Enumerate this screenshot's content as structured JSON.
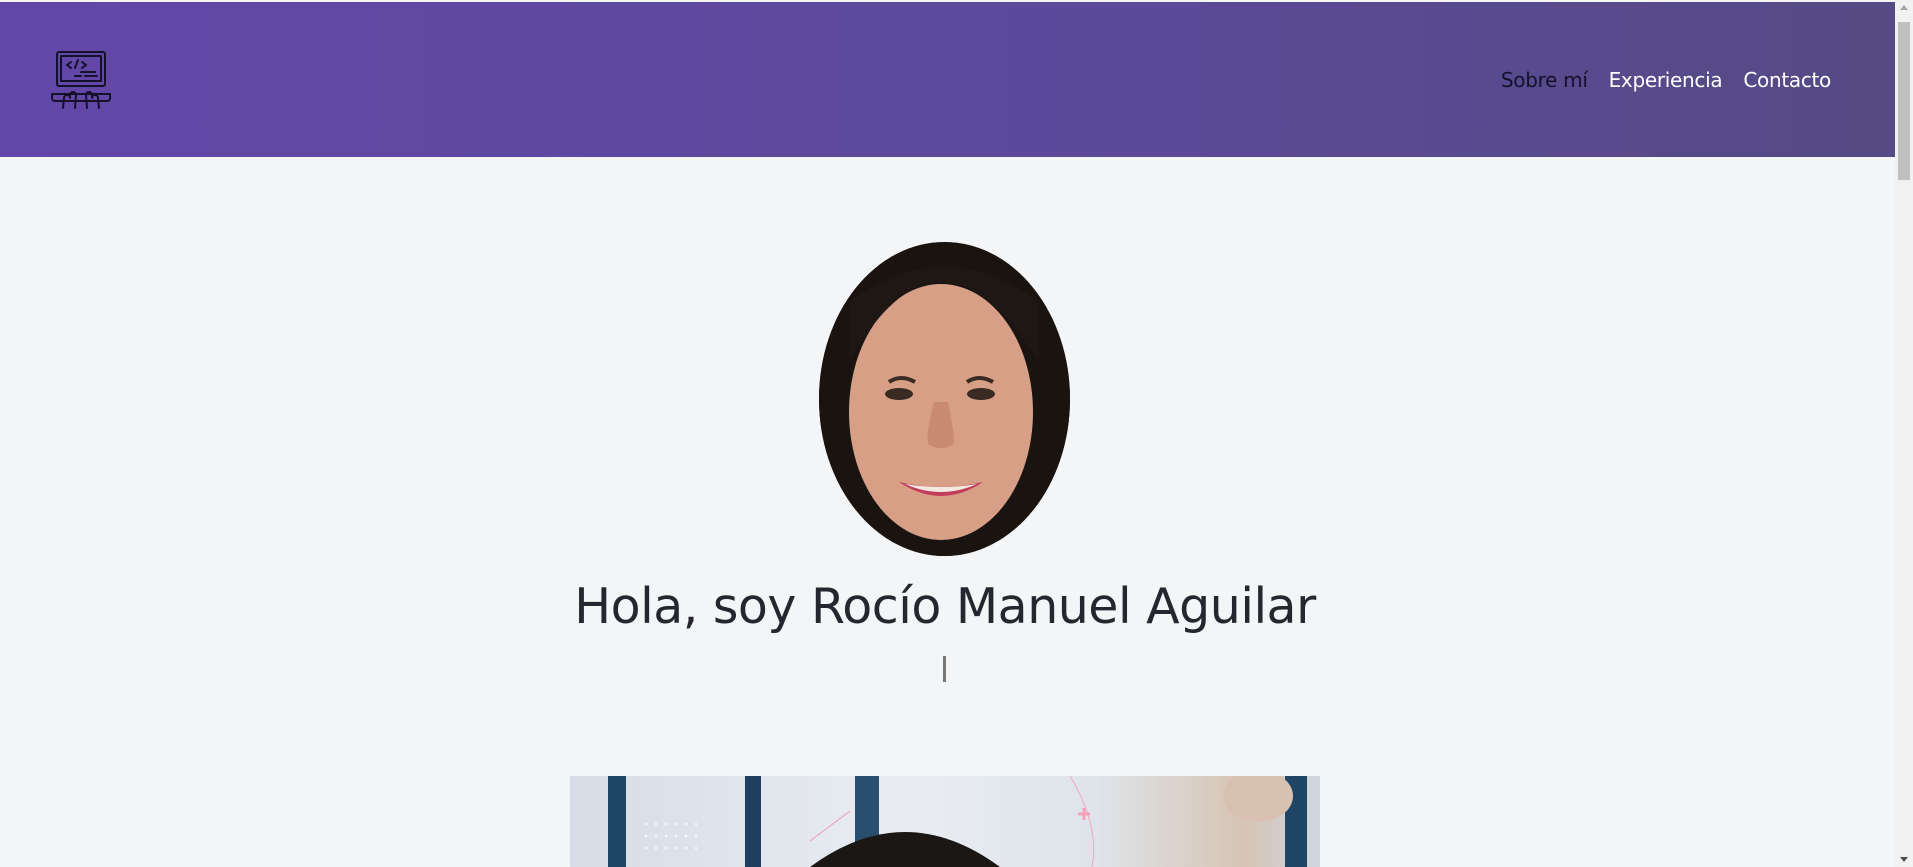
{
  "header": {
    "logo_icon": "laptop-code-icon",
    "nav": [
      {
        "label": "Sobre mí",
        "active": true
      },
      {
        "label": "Experiencia",
        "active": false
      },
      {
        "label": "Contacto",
        "active": false
      }
    ]
  },
  "hero": {
    "title": "Hola, soy Rocío Manuel Aguilar",
    "typed_text": ""
  },
  "colors": {
    "header_gradient_start": "#6347a8",
    "header_gradient_end": "#564a84",
    "background": "#f4f5f7",
    "title": "#25262e"
  }
}
